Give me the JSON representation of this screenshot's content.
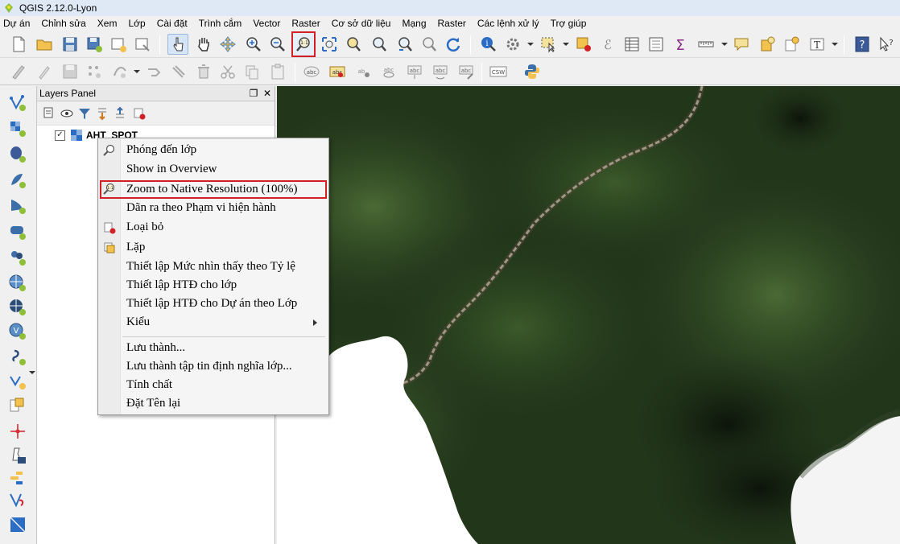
{
  "window": {
    "title": "QGIS 2.12.0-Lyon"
  },
  "menubar": {
    "items": [
      "Dự án",
      "Chỉnh sửa",
      "Xem",
      "Lớp",
      "Cài đặt",
      "Trình cắm",
      "Vector",
      "Raster",
      "Cơ sở dữ liệu",
      "Mạng",
      "Raster",
      "Các lệnh xử lý",
      "Trợ giúp"
    ]
  },
  "toolbar2": {
    "csw_label": "CSW"
  },
  "layers_panel": {
    "title": "Layers Panel",
    "layer": {
      "name": "AHT_SPOT",
      "checked": true
    }
  },
  "context_menu": {
    "items": [
      {
        "label": "Phóng đến lớp",
        "icon": "zoom-layer-icon"
      },
      {
        "label": "Show in Overview",
        "icon": ""
      },
      {
        "label": "Zoom to Native Resolution (100%)",
        "icon": "zoom-native-icon",
        "highlighted": true
      },
      {
        "label": "Dãn ra theo Phạm vi hiện hành",
        "icon": ""
      },
      {
        "label": "Loại bỏ",
        "icon": "remove-layer-icon"
      },
      {
        "label": "Lặp",
        "icon": "duplicate-layer-icon"
      },
      {
        "label": "Thiết lập Mức nhìn thấy theo Tỷ lệ",
        "icon": ""
      },
      {
        "label": "Thiết lập HTĐ cho lớp",
        "icon": ""
      },
      {
        "label": "Thiết lập HTĐ cho Dự án theo Lớp",
        "icon": ""
      },
      {
        "label": "Kiểu",
        "icon": "",
        "submenu": true
      },
      {
        "label": "Lưu thành...",
        "icon": ""
      },
      {
        "label": "Lưu thành tập tin định nghĩa lớp...",
        "icon": ""
      },
      {
        "label": "Tính chất",
        "icon": ""
      },
      {
        "label": "Đặt Tên lại",
        "icon": ""
      }
    ]
  },
  "colors": {
    "highlight_border": "#d32027",
    "menu_bg": "#f5f5f5",
    "map_forest": "#1e3018"
  }
}
